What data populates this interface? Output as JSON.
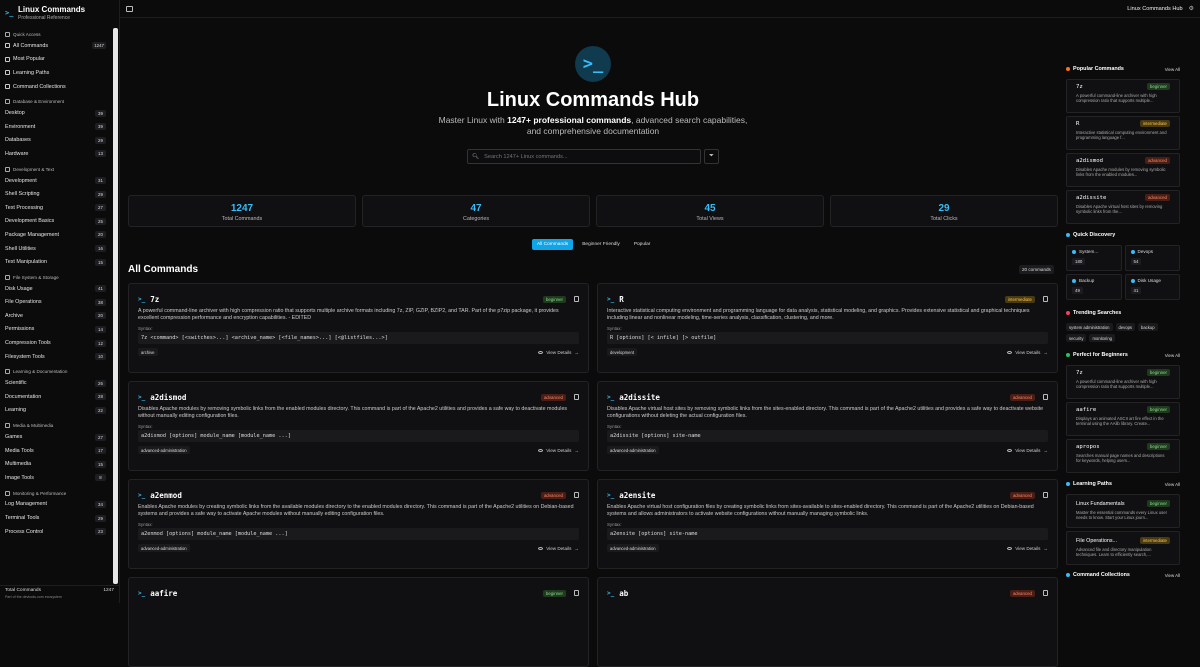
{
  "brand": {
    "title": "Linux Commands",
    "subtitle": "Professional Reference"
  },
  "sidebar": {
    "sections": [
      {
        "title": "Quick Access",
        "items": [
          {
            "label": "All Commands",
            "count": "1247"
          },
          {
            "label": "Most Popular",
            "count": ""
          },
          {
            "label": "Learning Paths",
            "count": ""
          },
          {
            "label": "Command Collections",
            "count": ""
          }
        ]
      },
      {
        "title": "Database & Environment",
        "items": [
          {
            "label": "Desktop",
            "count": "39"
          },
          {
            "label": "Environment",
            "count": "39"
          },
          {
            "label": "Databases",
            "count": "29"
          },
          {
            "label": "Hardware",
            "count": "13"
          }
        ]
      },
      {
        "title": "Development & Text",
        "items": [
          {
            "label": "Development",
            "count": "31"
          },
          {
            "label": "Shell Scripting",
            "count": "29"
          },
          {
            "label": "Text Processing",
            "count": "27"
          },
          {
            "label": "Development Basics",
            "count": "25"
          },
          {
            "label": "Package Management",
            "count": "20"
          },
          {
            "label": "Shell Utilities",
            "count": "16"
          },
          {
            "label": "Text Manipulation",
            "count": "15"
          }
        ]
      },
      {
        "title": "File System & Storage",
        "items": [
          {
            "label": "Disk Usage",
            "count": "41"
          },
          {
            "label": "File Operations",
            "count": "38"
          },
          {
            "label": "Archive",
            "count": "20"
          },
          {
            "label": "Permissions",
            "count": "14"
          },
          {
            "label": "Compression Tools",
            "count": "12"
          },
          {
            "label": "Filesystem Tools",
            "count": "10"
          }
        ]
      },
      {
        "title": "Learning & Documentation",
        "items": [
          {
            "label": "Scientific",
            "count": "26"
          },
          {
            "label": "Documentation",
            "count": "28"
          },
          {
            "label": "Learning",
            "count": "22"
          }
        ]
      },
      {
        "title": "Media & Multimedia",
        "items": [
          {
            "label": "Games",
            "count": "27"
          },
          {
            "label": "Media Tools",
            "count": "17"
          },
          {
            "label": "Multimedia",
            "count": "15"
          },
          {
            "label": "Image Tools",
            "count": "8"
          }
        ]
      },
      {
        "title": "Monitoring & Performance",
        "items": [
          {
            "label": "Log Management",
            "count": "34"
          },
          {
            "label": "Terminal Tools",
            "count": "29"
          },
          {
            "label": "Process Control",
            "count": "23"
          }
        ]
      }
    ],
    "footer": {
      "label": "Total Commands",
      "count": "1247",
      "note": "Part of the devtools.com ecosystem"
    }
  },
  "topbar": {
    "title": "Linux Commands Hub"
  },
  "hero": {
    "title": "Linux Commands Hub",
    "sub_pre": "Master Linux with ",
    "sub_bold": "1247+ professional commands",
    "sub_post": ", advanced search capabilities,",
    "sub_line2": "and comprehensive documentation",
    "search_placeholder": "Search 1247+ Linux commands..."
  },
  "stats": [
    {
      "value": "1247",
      "label": "Total Commands"
    },
    {
      "value": "47",
      "label": "Categories"
    },
    {
      "value": "45",
      "label": "Total Views"
    },
    {
      "value": "29",
      "label": "Total Clicks"
    }
  ],
  "tabs": [
    "All Commands",
    "Beginner Friendly",
    "Popular"
  ],
  "list": {
    "title": "All Commands",
    "count": "20 commands",
    "syntax_label": "Syntax:",
    "view_details": "View Details"
  },
  "commands": [
    {
      "name": "7z",
      "level": "beginner",
      "desc": "A powerful command-line archiver with high compression ratio that supports multiple archive formats including 7z, ZIP, GZIP, BZIP2, and TAR. Part of the p7zip package, it provides excellent compression performance and encryption capabilities. - EDITED",
      "syntax": "7z <command> [<switches>...] <archive_name> [<file_names>...] [<@listfiles...>]",
      "tag": "archive"
    },
    {
      "name": "R",
      "level": "intermediate",
      "desc": "Interactive statistical computing environment and programming language for data analysis, statistical modeling, and graphics. Provides extensive statistical and graphical techniques including linear and nonlinear modeling, time-series analysis, classification, clustering, and more.",
      "syntax": "R [options] [< infile] [> outfile]",
      "tag": "development"
    },
    {
      "name": "a2dismod",
      "level": "advanced",
      "desc": "Disables Apache modules by removing symbolic links from the enabled modules directory. This command is part of the Apache2 utilities and provides a safe way to deactivate modules without manually editing configuration files.",
      "syntax": "a2dismod [options] module_name [module_name ...]",
      "tag": "advanced-administration"
    },
    {
      "name": "a2dissite",
      "level": "advanced",
      "desc": "Disables Apache virtual host sites by removing symbolic links from the sites-enabled directory. This command is part of the Apache2 utilities and provides a safe way to deactivate website configurations without deleting the actual configuration files.",
      "syntax": "a2dissite [options] site-name",
      "tag": "advanced-administration"
    },
    {
      "name": "a2enmod",
      "level": "advanced",
      "desc": "Enables Apache modules by creating symbolic links from the available modules directory to the enabled modules directory. This command is part of the Apache2 utilities on Debian-based systems and provides a safe way to activate Apache modules without manually editing configuration files.",
      "syntax": "a2enmod [options] module_name [module_name ...]",
      "tag": "advanced-administration"
    },
    {
      "name": "a2ensite",
      "level": "advanced",
      "desc": "Enables Apache virtual host configuration files by creating symbolic links from sites-available to sites-enabled directory. This command is part of the Apache2 utilities on Debian-based systems and allows administrators to activate website configurations without manually managing symbolic links.",
      "syntax": "a2ensite [options] site-name",
      "tag": "advanced-administration"
    },
    {
      "name": "aafire",
      "level": "beginner",
      "desc": "",
      "syntax": "",
      "tag": ""
    },
    {
      "name": "ab",
      "level": "advanced",
      "desc": "",
      "syntax": "",
      "tag": ""
    }
  ],
  "right": {
    "view_all": "View All",
    "popular_title": "Popular Commands",
    "popular": [
      {
        "name": "7z",
        "level": "beginner",
        "desc": "A powerful command-line archiver with high compression ratio that supports multiple..."
      },
      {
        "name": "R",
        "level": "intermediate",
        "desc": "Interactive statistical computing environment and programming language f..."
      },
      {
        "name": "a2dismod",
        "level": "advanced",
        "desc": "Disables Apache modules by removing symbolic links from the enabled modules..."
      },
      {
        "name": "a2dissite",
        "level": "advanced",
        "desc": "Disables Apache virtual host sites by removing symbolic links from the..."
      }
    ],
    "quick_title": "Quick Discovery",
    "quick": [
      {
        "name": "System...",
        "value": "180"
      },
      {
        "name": "Devops",
        "value": "54"
      },
      {
        "name": "Backup",
        "value": "49"
      },
      {
        "name": "Disk Usage",
        "value": "41"
      }
    ],
    "trending_title": "Trending Searches",
    "trending": [
      "system administration",
      "devops",
      "backup",
      "security",
      "monitoring"
    ],
    "beginners_title": "Perfect for Beginners",
    "beginners": [
      {
        "name": "7z",
        "level": "beginner",
        "desc": "A powerful command-line archiver with high compression ratio that supports multiple..."
      },
      {
        "name": "aafire",
        "level": "beginner",
        "desc": "Displays an animated ASCII art fire effect in the terminal using the AAlib library. Create..."
      },
      {
        "name": "apropos",
        "level": "beginner",
        "desc": "Searches manual page names and descriptions for keywords, helping users..."
      }
    ],
    "paths_title": "Learning Paths",
    "paths": [
      {
        "name": "Linux Fundamentals",
        "level": "beginner",
        "desc": "Master the essential commands every Linux user needs to know. Start your Linux journ..."
      },
      {
        "name": "File Operations...",
        "level": "intermediate",
        "desc": "Advanced file and directory manipulation techniques. Learn to efficiently search,..."
      }
    ],
    "collections_title": "Command Collections"
  }
}
